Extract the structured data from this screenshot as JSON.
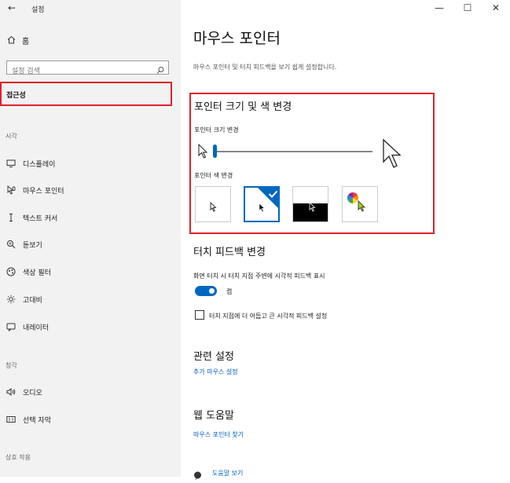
{
  "titlebar": {
    "back_glyph": "←",
    "title": "설정",
    "minimize": "—",
    "maximize": "☐",
    "close": "✕"
  },
  "sidebar": {
    "home_label": "홈",
    "search_placeholder": "설정 검색",
    "selected_category": "접근성",
    "sections": [
      {
        "label": "시각",
        "items": [
          "디스플레이",
          "마우스 포인터",
          "텍스트 커서",
          "돋보기",
          "색상 필터",
          "고대비",
          "내레이터"
        ]
      },
      {
        "label": "청각",
        "items": [
          "오디오",
          "선택 자막"
        ]
      },
      {
        "label": "상호 작용",
        "items": []
      }
    ]
  },
  "main": {
    "title": "마우스 포인터",
    "subtitle": "마우스 포인터 및 터치 피드백을 보기 쉽게 설정합니다.",
    "pointer_section": {
      "heading": "포인터 크기 및 색 변경",
      "size_label": "포인터 크기 변경",
      "size_level": 1,
      "color_label": "포인터 색 변경",
      "selected_color_index": 1
    },
    "touch_section": {
      "heading": "터치 피드백 변경",
      "feedback_label": "화면 터치 시 터치 지점 주변에 시각적 피드백 표시",
      "toggle_state": "켬",
      "checkbox_label": "터치 지점에 더 어둡고 큰 시각적 피드백 설정"
    },
    "related": {
      "heading": "관련 설정",
      "link": "추가 마우스 설정"
    },
    "help": {
      "heading": "웹 도움말",
      "link": "마우스 포인터 찾기"
    },
    "bottom_link": "도움말 보기"
  },
  "colors": {
    "accent": "#0067c0",
    "highlight_border": "#e0202a",
    "sidebar_bg": "#f2f2f2"
  }
}
